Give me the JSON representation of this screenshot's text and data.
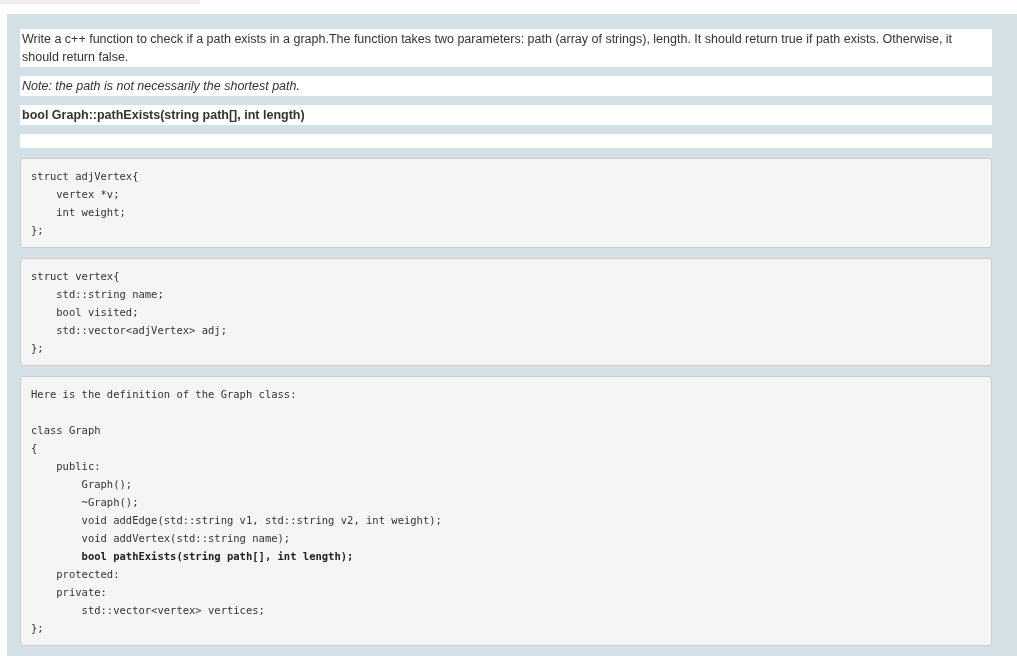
{
  "question": {
    "text": "Write a c++ function to check if a path exists in a graph.The function takes two parameters: path (array of strings), length. It should return true if path exists. Otherwise, it should return false.",
    "note": "Note: the path is not necessarily the shortest path.",
    "signature": "bool Graph::pathExists(string path[], int length)"
  },
  "code_blocks": [
    {
      "lines": [
        "struct adjVertex{",
        "    vertex *v;",
        "    int weight;",
        "};"
      ]
    },
    {
      "lines": [
        "struct vertex{",
        "    std::string name;",
        "    bool visited;",
        "    std::vector<adjVertex> adj;",
        "};"
      ]
    },
    {
      "intro": "Here is the definition of the Graph class:",
      "lines": [
        "class Graph",
        "{",
        "    public:",
        "        Graph();",
        "        ~Graph();",
        "        void addEdge(std::string v1, std::string v2, int weight);",
        "        void addVertex(std::string name);",
        "        **bool pathExists(string path[], int length);**",
        "    protected:",
        "    private:",
        "        std::vector<vertex> vertices;",
        "};"
      ]
    }
  ]
}
